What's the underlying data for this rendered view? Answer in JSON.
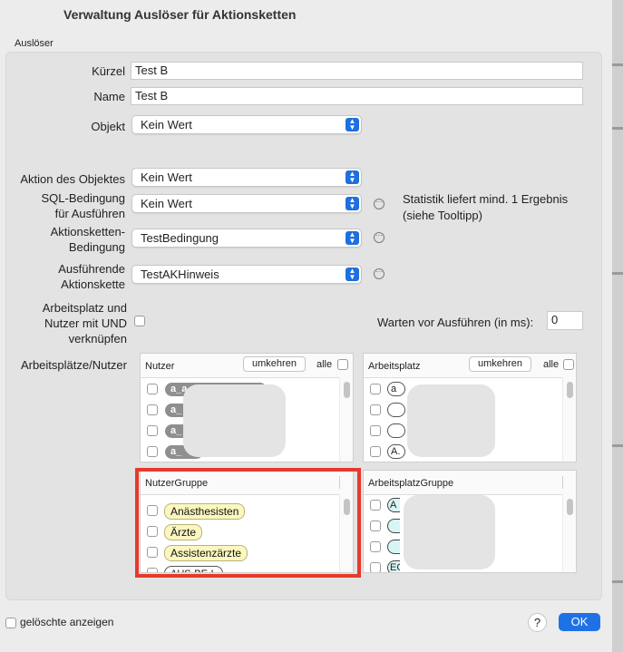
{
  "window": {
    "title": "Verwaltung Auslöser für Aktionsketten"
  },
  "group_label": "Auslöser",
  "fields": {
    "kuerzel": {
      "label": "Kürzel",
      "value": "Test B"
    },
    "name": {
      "label": "Name",
      "value": "Test B"
    },
    "objekt": {
      "label": "Objekt",
      "value": "Kein Wert"
    },
    "aktion": {
      "label": "Aktion des Objektes",
      "value": "Kein Wert"
    },
    "sql": {
      "label1": "SQL-Bedingung",
      "label2": "für Ausführen",
      "value": "Kein Wert"
    },
    "ak_bedingung": {
      "label1": "Aktionsketten-",
      "label2": "Bedingung",
      "value": "TestBedingung"
    },
    "ausfuehrende": {
      "label1": "Ausführende",
      "label2": "Aktionskette",
      "value": "TestAKHinweis"
    },
    "arbeitsplatz_und": {
      "label1": "Arbeitsplatz und",
      "label2": "Nutzer mit UND",
      "label3": "verknüpfen"
    },
    "warten": {
      "label": "Warten vor Ausführen (in ms):",
      "value": "0"
    }
  },
  "statistik_note": {
    "line1": "Statistik liefert mind. 1 Ergebnis",
    "line2": "(siehe Tooltipp)"
  },
  "arbeitsplaetze_label": "Arbeitsplätze/Nutzer",
  "nutzer_box": {
    "header": "Nutzer",
    "umkehren": "umkehren",
    "alle": "alle",
    "items": [
      "a_a",
      "a_",
      "a_",
      "a_"
    ]
  },
  "arbeitsplatz_box": {
    "header": "Arbeitsplatz",
    "umkehren": "umkehren",
    "alle": "alle",
    "items": [
      "a",
      "",
      "",
      "A."
    ]
  },
  "nutzergruppe_box": {
    "header": "NutzerGruppe",
    "items": [
      "Anästhesisten",
      "Ärzte",
      "Assistenzärzte",
      "AUS-BE-L"
    ]
  },
  "arbeitsplatzgruppe_box": {
    "header": "ArbeitsplatzGruppe",
    "items": [
      "A",
      "",
      "",
      "EG"
    ]
  },
  "footer": {
    "geloeschte": "gelöschte anzeigen",
    "help": "?",
    "ok": "OK"
  },
  "colors": {
    "accent": "#1e72e6",
    "highlight": "#e53a2c",
    "pill_yellow": "#fbf7bf",
    "pill_grey": "#8f8f8f"
  }
}
